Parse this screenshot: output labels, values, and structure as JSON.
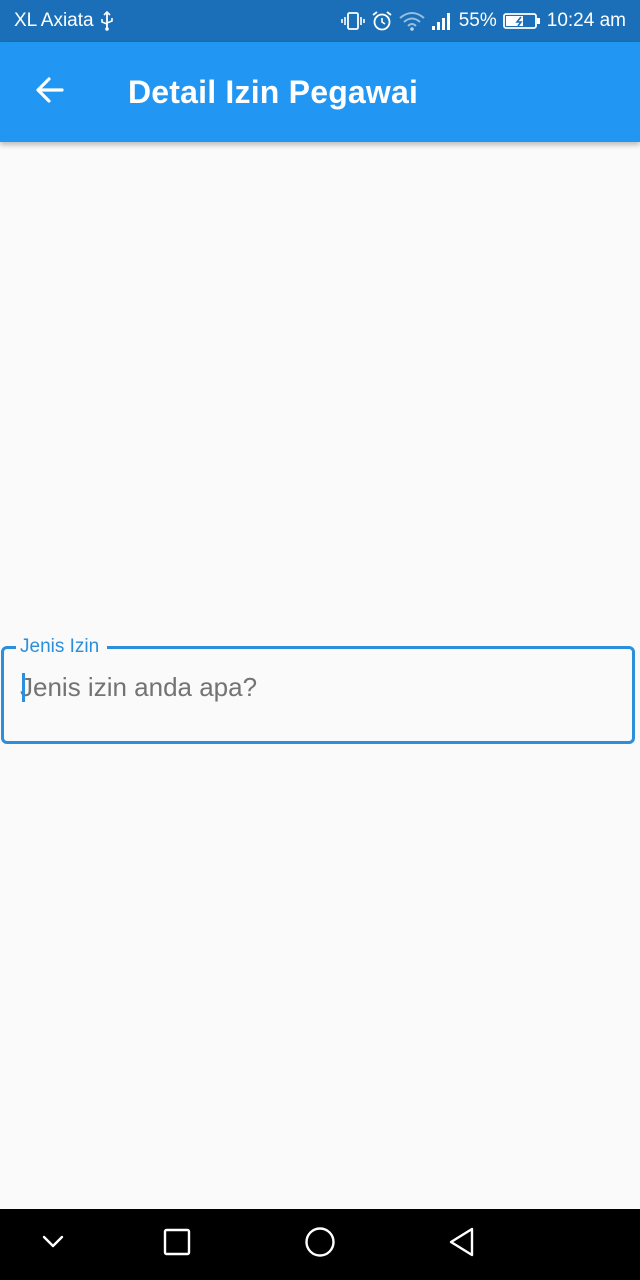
{
  "status_bar": {
    "carrier": "XL Axiata",
    "battery_percent": "55%",
    "time": "10:24 am",
    "icons": [
      "usb-icon",
      "vibrate-icon",
      "alarm-icon",
      "wifi-icon",
      "signal-icon",
      "battery-charging-icon"
    ]
  },
  "app_bar": {
    "title": "Detail Izin Pegawai",
    "back_icon": "arrow-left-icon",
    "color": "#2196f3"
  },
  "form": {
    "field_label": "Jenis Izin",
    "field_placeholder": "Jenis izin anda apa?",
    "field_value": "",
    "accent_color": "#2b8fdc"
  },
  "nav_bar": {
    "icons": [
      "chevron-down-icon",
      "recents-square-icon",
      "home-circle-icon",
      "back-triangle-icon"
    ]
  }
}
